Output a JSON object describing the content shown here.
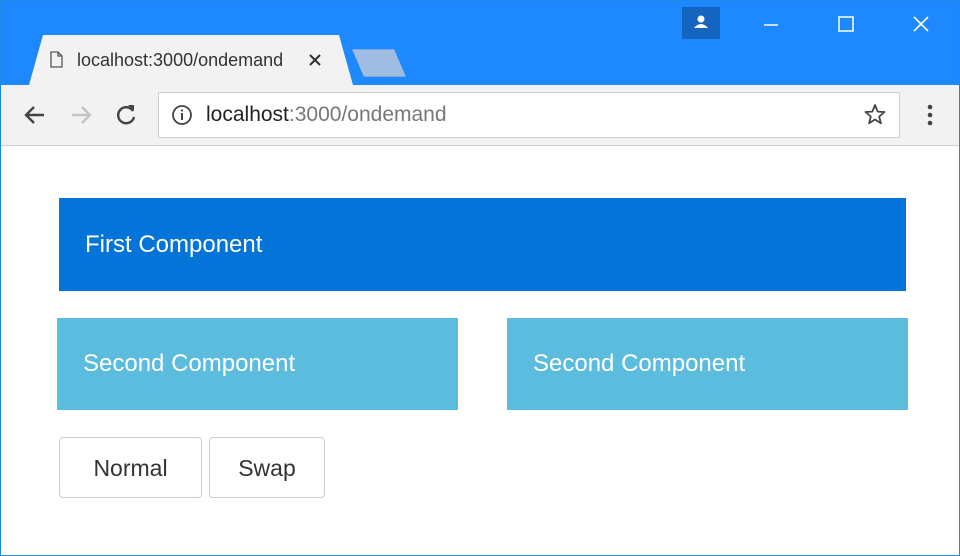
{
  "browser": {
    "tab_title": "localhost:3000/ondemand",
    "url_host": "localhost",
    "url_rest": ":3000/ondemand",
    "icons": {
      "tab": "page-icon",
      "tab_close": "close-icon",
      "profile": "person-icon",
      "minimize": "minimize-icon",
      "maximize": "maximize-icon",
      "close": "close-icon",
      "back": "back-arrow-icon",
      "forward": "forward-arrow-icon",
      "reload": "reload-icon",
      "site_info": "info-icon",
      "bookmark": "star-icon",
      "menu": "kebab-menu-icon"
    },
    "colors": {
      "titlebar": "#1e88ff",
      "toolbar": "#f2f2f2"
    }
  },
  "page": {
    "first_component_label": "First Component",
    "second_components": [
      "Second Component",
      "Second Component"
    ],
    "buttons": {
      "normal_label": "Normal",
      "swap_label": "Swap"
    },
    "colors": {
      "primary": "#0474d8",
      "info": "#5bbcde"
    }
  }
}
